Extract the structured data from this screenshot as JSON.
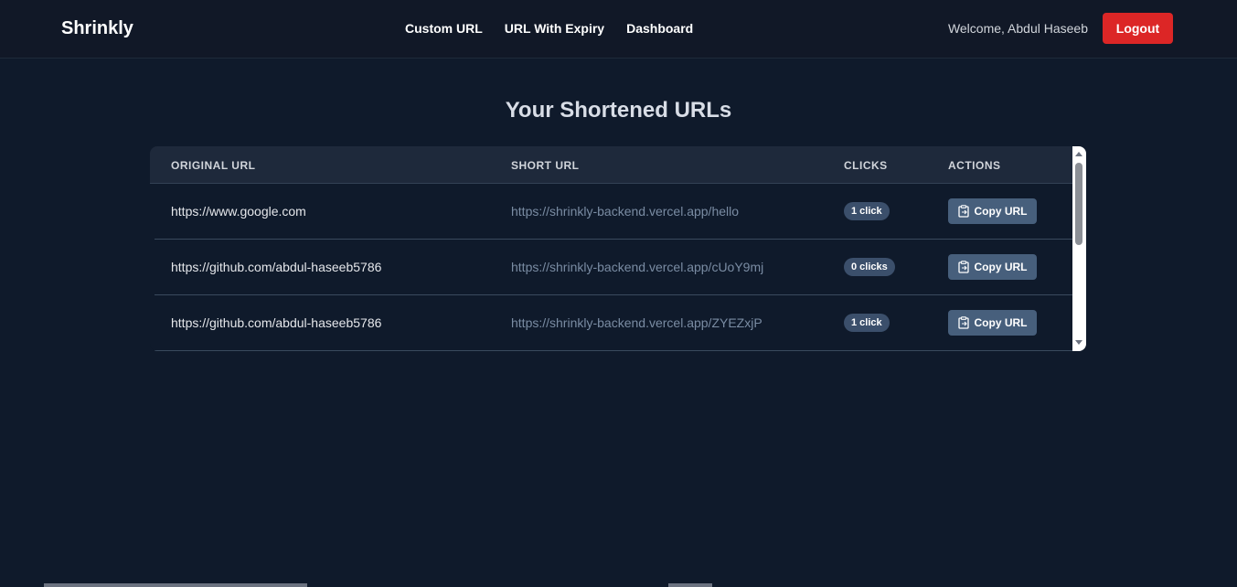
{
  "nav": {
    "brand": "Shrinkly",
    "links": [
      "Custom URL",
      "URL With Expiry",
      "Dashboard"
    ],
    "welcome": "Welcome, Abdul Haseeb",
    "logout_label": "Logout"
  },
  "main": {
    "title": "Your Shortened URLs",
    "table": {
      "headers": [
        "ORIGINAL URL",
        "SHORT URL",
        "CLICKS",
        "ACTIONS"
      ],
      "rows": [
        {
          "original": "https://www.google.com",
          "short": "https://shrinkly-backend.vercel.app/hello",
          "clicks": "1 click",
          "action": "Copy URL"
        },
        {
          "original": "https://github.com/abdul-haseeb5786",
          "short": "https://shrinkly-backend.vercel.app/cUoY9mj",
          "clicks": "0 clicks",
          "action": "Copy URL"
        },
        {
          "original": "https://github.com/abdul-haseeb5786",
          "short": "https://shrinkly-backend.vercel.app/ZYEZxjP",
          "clicks": "1 click",
          "action": "Copy URL"
        }
      ]
    }
  },
  "colors": {
    "background": "#0f1a2b",
    "navbar": "#111827",
    "logout": "#dc2626",
    "badge": "#3b4f6b",
    "copy_button": "#475f7c"
  },
  "icons": {
    "copy": "clipboard-icon"
  }
}
